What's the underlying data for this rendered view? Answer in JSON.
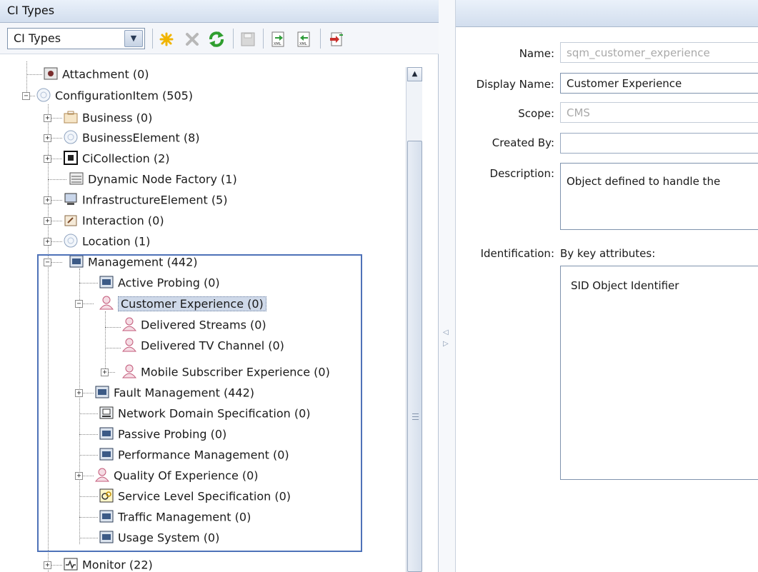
{
  "left_panel": {
    "title": "CI Types",
    "combo_value": "CI Types"
  },
  "toolbar_icons": [
    "new-icon",
    "delete-icon",
    "refresh-icon",
    "save-icon",
    "export-xml-icon",
    "import-xml-icon",
    "import-export-icon"
  ],
  "tree": [
    {
      "label": "Attachment (0)",
      "icon": "attachment-icon"
    },
    {
      "label": "ConfigurationItem (505)",
      "icon": "configuration-item-icon"
    },
    {
      "label": "Business (0)",
      "icon": "business-icon"
    },
    {
      "label": "BusinessElement (8)",
      "icon": "business-element-icon"
    },
    {
      "label": "CiCollection (2)",
      "icon": "ci-collection-icon"
    },
    {
      "label": "Dynamic Node Factory (1)",
      "icon": "dynamic-node-factory-icon"
    },
    {
      "label": "InfrastructureElement (5)",
      "icon": "infrastructure-element-icon"
    },
    {
      "label": "Interaction (0)",
      "icon": "interaction-icon"
    },
    {
      "label": "Location (1)",
      "icon": "location-icon"
    },
    {
      "label": "Management (442)",
      "icon": "management-icon"
    },
    {
      "label": "Active Probing (0)",
      "icon": "management-icon"
    },
    {
      "label": "Customer Experience (0)",
      "icon": "person-icon"
    },
    {
      "label": "Delivered Streams (0)",
      "icon": "person-icon"
    },
    {
      "label": "Delivered TV Channel (0)",
      "icon": "person-icon"
    },
    {
      "label": "Mobile Subscriber Experience (0)",
      "icon": "person-icon"
    },
    {
      "label": "Fault Management (442)",
      "icon": "management-icon"
    },
    {
      "label": "Network Domain Specification (0)",
      "icon": "network-domain-icon"
    },
    {
      "label": "Passive Probing (0)",
      "icon": "management-icon"
    },
    {
      "label": "Performance Management (0)",
      "icon": "management-icon"
    },
    {
      "label": "Quality Of Experience (0)",
      "icon": "person-icon"
    },
    {
      "label": "Service Level Specification (0)",
      "icon": "service-level-icon"
    },
    {
      "label": "Traffic Management (0)",
      "icon": "management-icon"
    },
    {
      "label": "Usage System (0)",
      "icon": "management-icon"
    },
    {
      "label": "Monitor (22)",
      "icon": "monitor-icon"
    }
  ],
  "form": {
    "name_label": "Name:",
    "name_value": "sqm_customer_experience",
    "display_name_label": "Display Name:",
    "display_name_value": "Customer Experience",
    "scope_label": "Scope:",
    "scope_value": "CMS",
    "created_by_label": "Created By:",
    "created_by_value": "",
    "description_label": "Description:",
    "description_value": "Object defined to handle the",
    "identification_label": "Identification:",
    "identification_value": "By key attributes:",
    "key_attributes": [
      "SID Object Identifier"
    ]
  },
  "colors": {
    "header_bg": "#d2deee",
    "selection_bg": "#cfd9e9",
    "highlight_border": "#4e72b8"
  }
}
